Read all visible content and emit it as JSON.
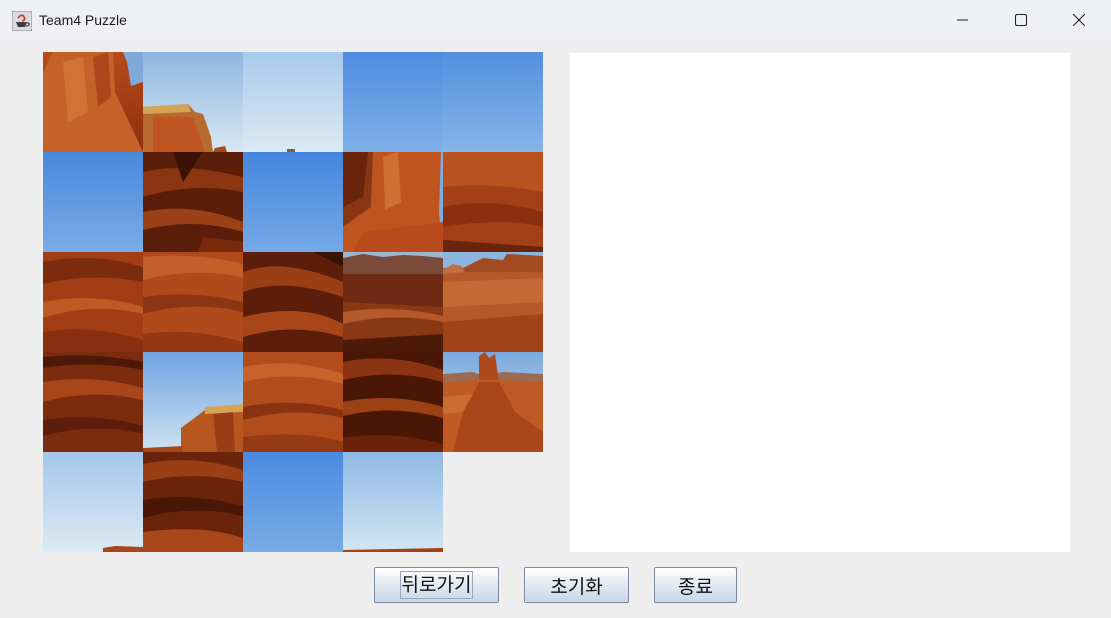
{
  "window": {
    "title": "Team4 Puzzle",
    "icon": "java-cup-icon",
    "controls": [
      "minimize-icon",
      "maximize-icon",
      "close-icon"
    ]
  },
  "puzzle": {
    "grid": "5x5",
    "tiles": [
      [
        "butte-left-top",
        "sky-butte-top",
        "sky-light",
        "sky-blue",
        "sky-blue"
      ],
      [
        "sky-blue",
        "dark-rock",
        "sky-blue",
        "butte-middle",
        "rock-red"
      ],
      [
        "rock-red-wide",
        "rock-red-wide",
        "dark-rock",
        "valley-mesa",
        "desert-mesa"
      ],
      [
        "rock-stripes",
        "sky-mesa",
        "rock-red",
        "dark-rock",
        "butte-spire"
      ],
      [
        "sky-horizon",
        "dark-rock",
        "sky-blue",
        "sky-horizon-light",
        "empty"
      ]
    ]
  },
  "buttons": {
    "back_label": "뒤로가기",
    "reset_label": "초기화",
    "quit_label": "종료"
  }
}
